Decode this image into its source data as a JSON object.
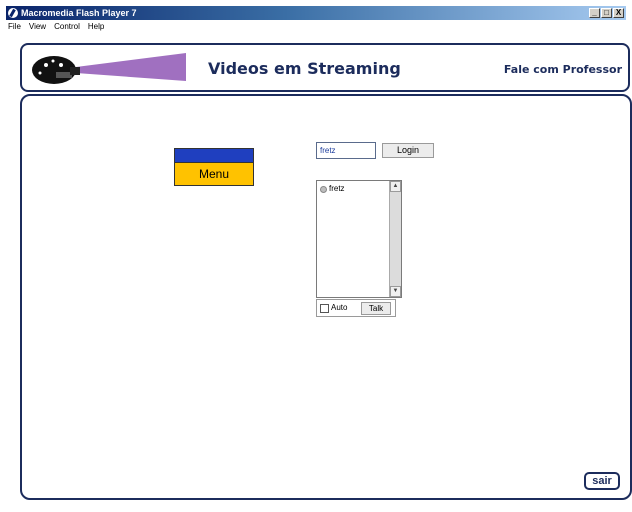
{
  "window": {
    "title": "Macromedia Flash Player 7",
    "buttons": [
      "_",
      "□",
      "X"
    ]
  },
  "menubar": {
    "items": [
      "File",
      "View",
      "Control",
      "Help"
    ]
  },
  "header": {
    "title": "Videos em Streaming",
    "contact_link": "Fale com Professor",
    "logo_icon": "camera-projector-icon"
  },
  "menu": {
    "label": "Menu",
    "colors": {
      "top": "#1f3fbf",
      "bottom": "#ffc200"
    }
  },
  "login": {
    "input_value": "fretz",
    "button_label": "Login"
  },
  "users": {
    "items": [
      {
        "name": "fretz",
        "status_icon": "user-status-icon"
      }
    ]
  },
  "talk": {
    "auto_label": "Auto",
    "auto_checked": false,
    "talk_label": "Talk"
  },
  "footer": {
    "sair_label": "sair"
  },
  "colors": {
    "brand_navy": "#1c2c5c",
    "beam_purple": "#a070c0"
  }
}
